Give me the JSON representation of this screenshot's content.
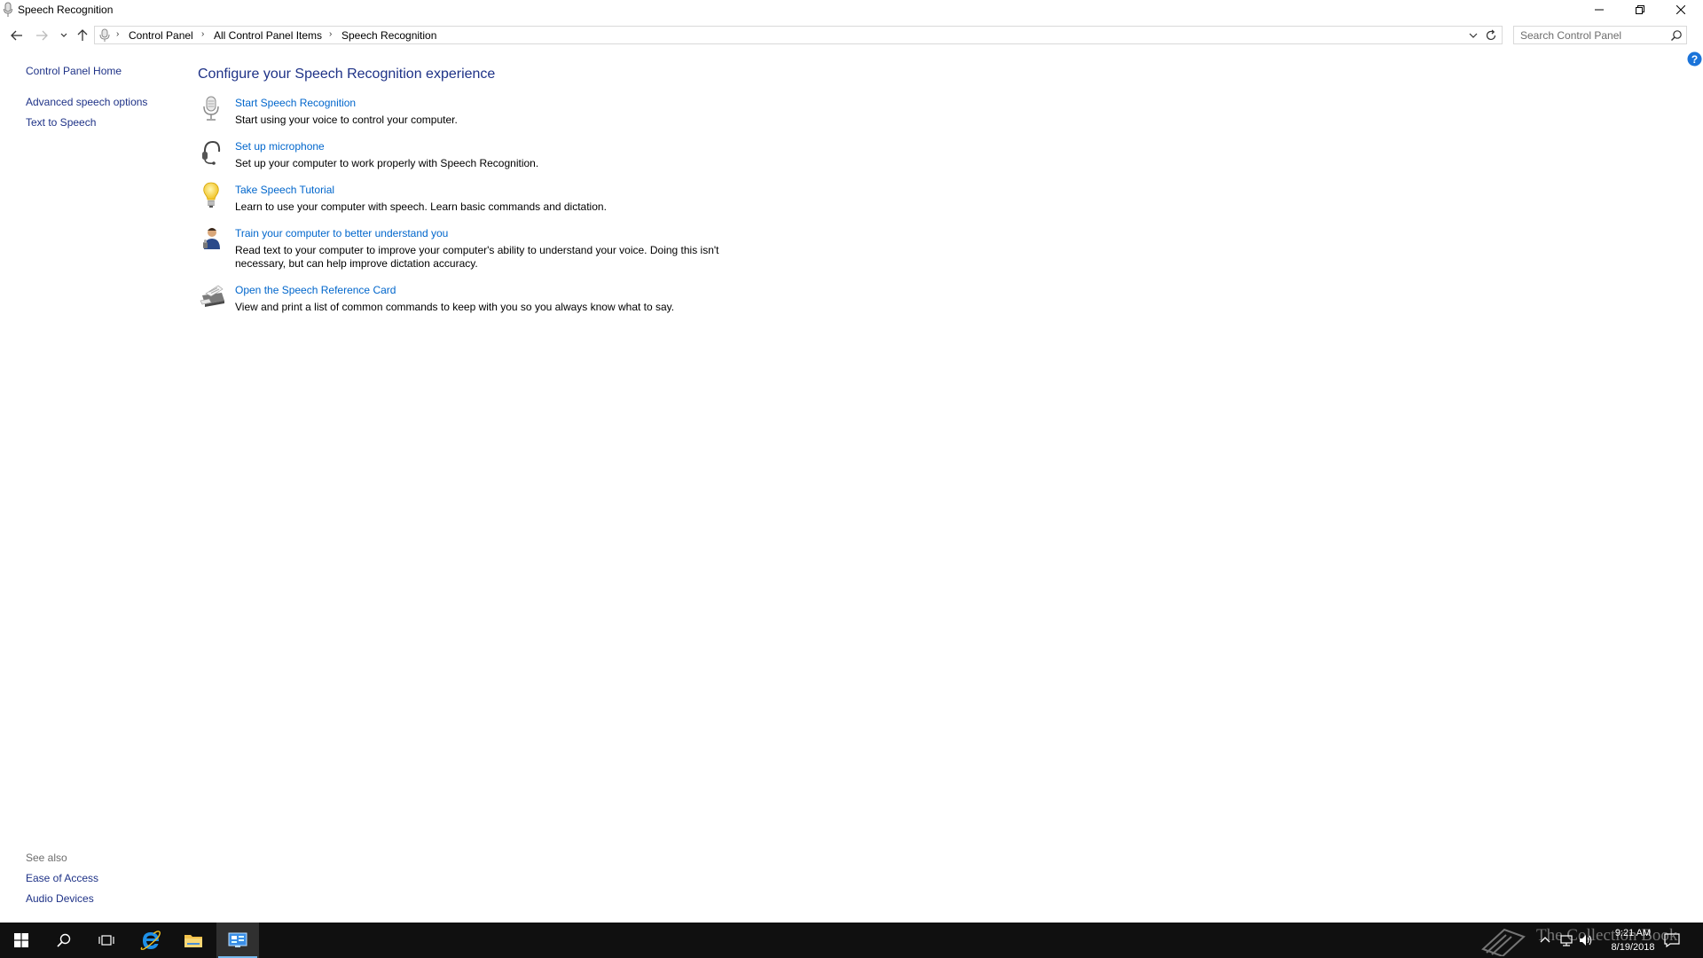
{
  "window": {
    "title": "Speech Recognition"
  },
  "address_bar": {
    "breadcrumbs": [
      "Control Panel",
      "All Control Panel Items",
      "Speech Recognition"
    ]
  },
  "search": {
    "placeholder": "Search Control Panel"
  },
  "sidebar": {
    "items": [
      {
        "label": "Control Panel Home"
      },
      {
        "label": "Advanced speech options"
      },
      {
        "label": "Text to Speech"
      }
    ],
    "see_also_label": "See also",
    "see_also": [
      {
        "label": "Ease of Access"
      },
      {
        "label": "Audio Devices"
      }
    ]
  },
  "main": {
    "heading": "Configure your Speech Recognition experience",
    "tasks": [
      {
        "icon": "microphone-icon",
        "link": "Start Speech Recognition",
        "desc": "Start using your voice to control your computer."
      },
      {
        "icon": "headset-icon",
        "link": "Set up microphone",
        "desc": "Set up your computer to work properly with Speech Recognition."
      },
      {
        "icon": "lightbulb-icon",
        "link": "Take Speech Tutorial",
        "desc": "Learn to use your computer with speech.  Learn basic commands and dictation."
      },
      {
        "icon": "user-train-icon",
        "link": "Train your computer to better understand you",
        "desc": "Read text to your computer to improve your computer's ability to understand your voice.  Doing this isn't necessary, but can help improve dictation accuracy."
      },
      {
        "icon": "printer-icon",
        "link": "Open the Speech Reference Card",
        "desc": "View and print a list of common commands to keep with you so you always know what to say."
      }
    ]
  },
  "taskbar": {
    "clock_time": "9:21 AM",
    "clock_date": "8/19/2018",
    "watermark": "The Collection Book",
    "accent": "#76b9ed"
  },
  "colors": {
    "link": "#0066cc",
    "nav_link": "#1e3287",
    "heading": "#1e3287",
    "taskbar": "#101010"
  }
}
